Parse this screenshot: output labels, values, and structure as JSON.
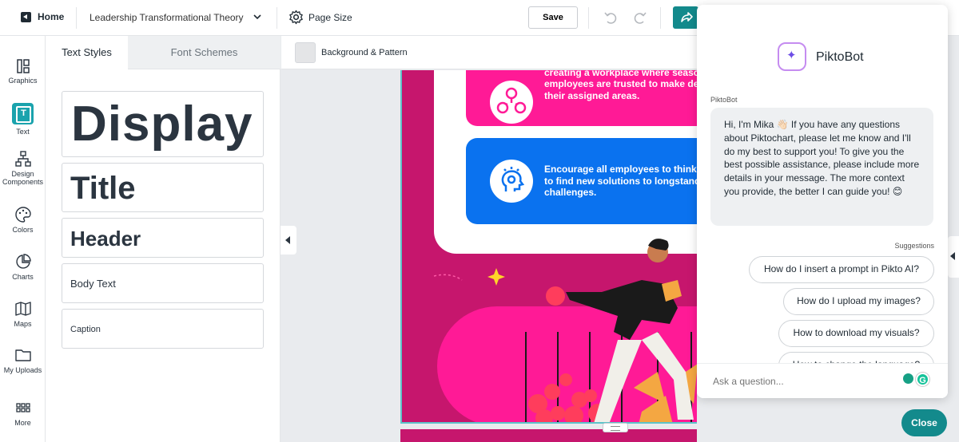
{
  "topbar": {
    "home_label": "Home",
    "document_title": "Leadership Transformational Theory",
    "page_size_label": "Page Size",
    "save_label": "Save"
  },
  "left_rail": {
    "items": [
      {
        "label": "Graphics",
        "icon": "graphics-icon"
      },
      {
        "label": "Text",
        "icon": "text-icon"
      },
      {
        "label": "Design Components",
        "icon": "design-components-icon"
      },
      {
        "label": "Colors",
        "icon": "palette-icon"
      },
      {
        "label": "Charts",
        "icon": "pie-chart-icon"
      },
      {
        "label": "Maps",
        "icon": "map-icon"
      },
      {
        "label": "My Uploads",
        "icon": "folder-icon"
      },
      {
        "label": "More",
        "icon": "grid-icon"
      }
    ]
  },
  "text_panel": {
    "tabs": [
      "Text Styles",
      "Font Schemes"
    ],
    "styles": {
      "display": "Display",
      "title": "Title",
      "header": "Header",
      "body": "Body Text",
      "caption": "Caption"
    }
  },
  "subbar": {
    "background_pattern_label": "Background & Pattern"
  },
  "infographic": {
    "card1_text": "Lead by communicating a clear vi\ncreating a workplace where seaso\nemployees are trusted to make de\ntheir assigned areas.",
    "card2_text": "Encourage all employees to think c\nto find new solutions to longstandin\nchallenges."
  },
  "chat": {
    "bot_name": "PiktoBot",
    "message_sender": "PiktoBot",
    "message": "Hi, I'm Mika 👋🏻 If you have any questions about Piktochart, please let me know and I'll do my best to support you! To give you the best possible assistance, please include more details in your message. The more context you provide, the better I can guide you! 😊",
    "suggestions_label": "Suggestions",
    "suggestions": [
      "How do I insert a prompt in Pikto AI?",
      "How do I upload my images?",
      "How to download my visuals?",
      "How to change the language?"
    ],
    "input_placeholder": "Ask a question...",
    "close_label": "Close"
  },
  "colors": {
    "accent_teal": "#138a8c",
    "magenta": "#c6166d",
    "hot_pink": "#ff1a96",
    "blue": "#0a72ef"
  }
}
